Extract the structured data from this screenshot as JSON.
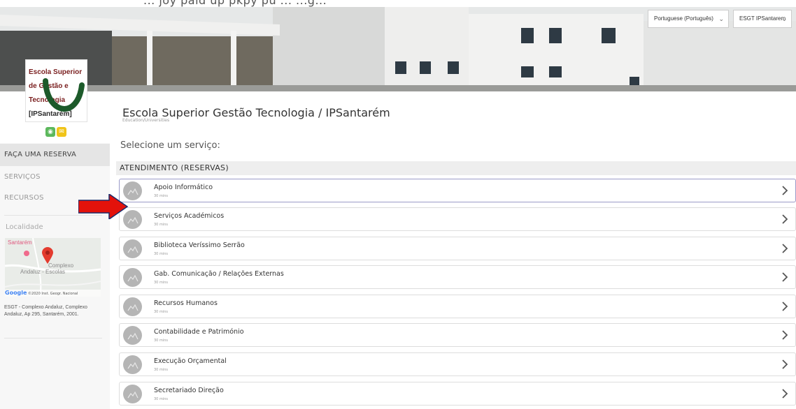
{
  "topbar": {
    "caption": "... joy paid up pkpy pu ... ...g..."
  },
  "language_select": {
    "value": "Portuguese (Português)"
  },
  "location_select": {
    "value": "ESGT IPSantarem"
  },
  "logo": {
    "line1": "Escola Superior",
    "line2": "de Gestão e",
    "line3": "Tecnologia",
    "line4": "[IPSantarém]"
  },
  "header": {
    "company_name": "Escola Superior Gestão Tecnologia / IPSantarém",
    "category": "Education/Universities"
  },
  "social": [
    {
      "icon": "globe-icon",
      "color": "#5cb85c"
    },
    {
      "icon": "email-icon",
      "color": "#f0c419"
    }
  ],
  "sidebar": {
    "items": [
      {
        "label": "FAÇA UMA RESERVA",
        "active": true
      },
      {
        "label": "SERVIÇOS",
        "active": false
      },
      {
        "label": "RECURSOS",
        "active": false
      }
    ],
    "location_title": "Localidade",
    "map": {
      "label_city": "Santarém",
      "label_place": "Complexo",
      "label_place2": "Andaluz - Escolas",
      "credit_brand": "Google",
      "credit_text": "©2020 Inst. Geogr. Nacional"
    },
    "address": "ESGT - Complexo Andaluz, Complexo Andaluz, Ap 295, Santarém, 2001."
  },
  "main": {
    "select_title": "Selecione um serviço:",
    "section_title": "ATENDIMENTO (RESERVAS)",
    "services": [
      {
        "name": "Apoio Informático",
        "duration": "30 mins"
      },
      {
        "name": "Serviços Académicos",
        "duration": "30 mins"
      },
      {
        "name": "Biblioteca Veríssimo Serrão",
        "duration": "30 mins"
      },
      {
        "name": "Gab. Comunicação / Relações Externas",
        "duration": "30 mins"
      },
      {
        "name": "Recursos Humanos",
        "duration": "30 mins"
      },
      {
        "name": "Contabilidade e Património",
        "duration": "30 mins"
      },
      {
        "name": "Execução Orçamental",
        "duration": "30 mins"
      },
      {
        "name": "Secretariado Direção",
        "duration": "30 mins"
      }
    ]
  },
  "colors": {
    "annotation_arrow": "#e3120b",
    "logo_green": "#1c5a2a",
    "logo_red": "#7a1f1f"
  }
}
